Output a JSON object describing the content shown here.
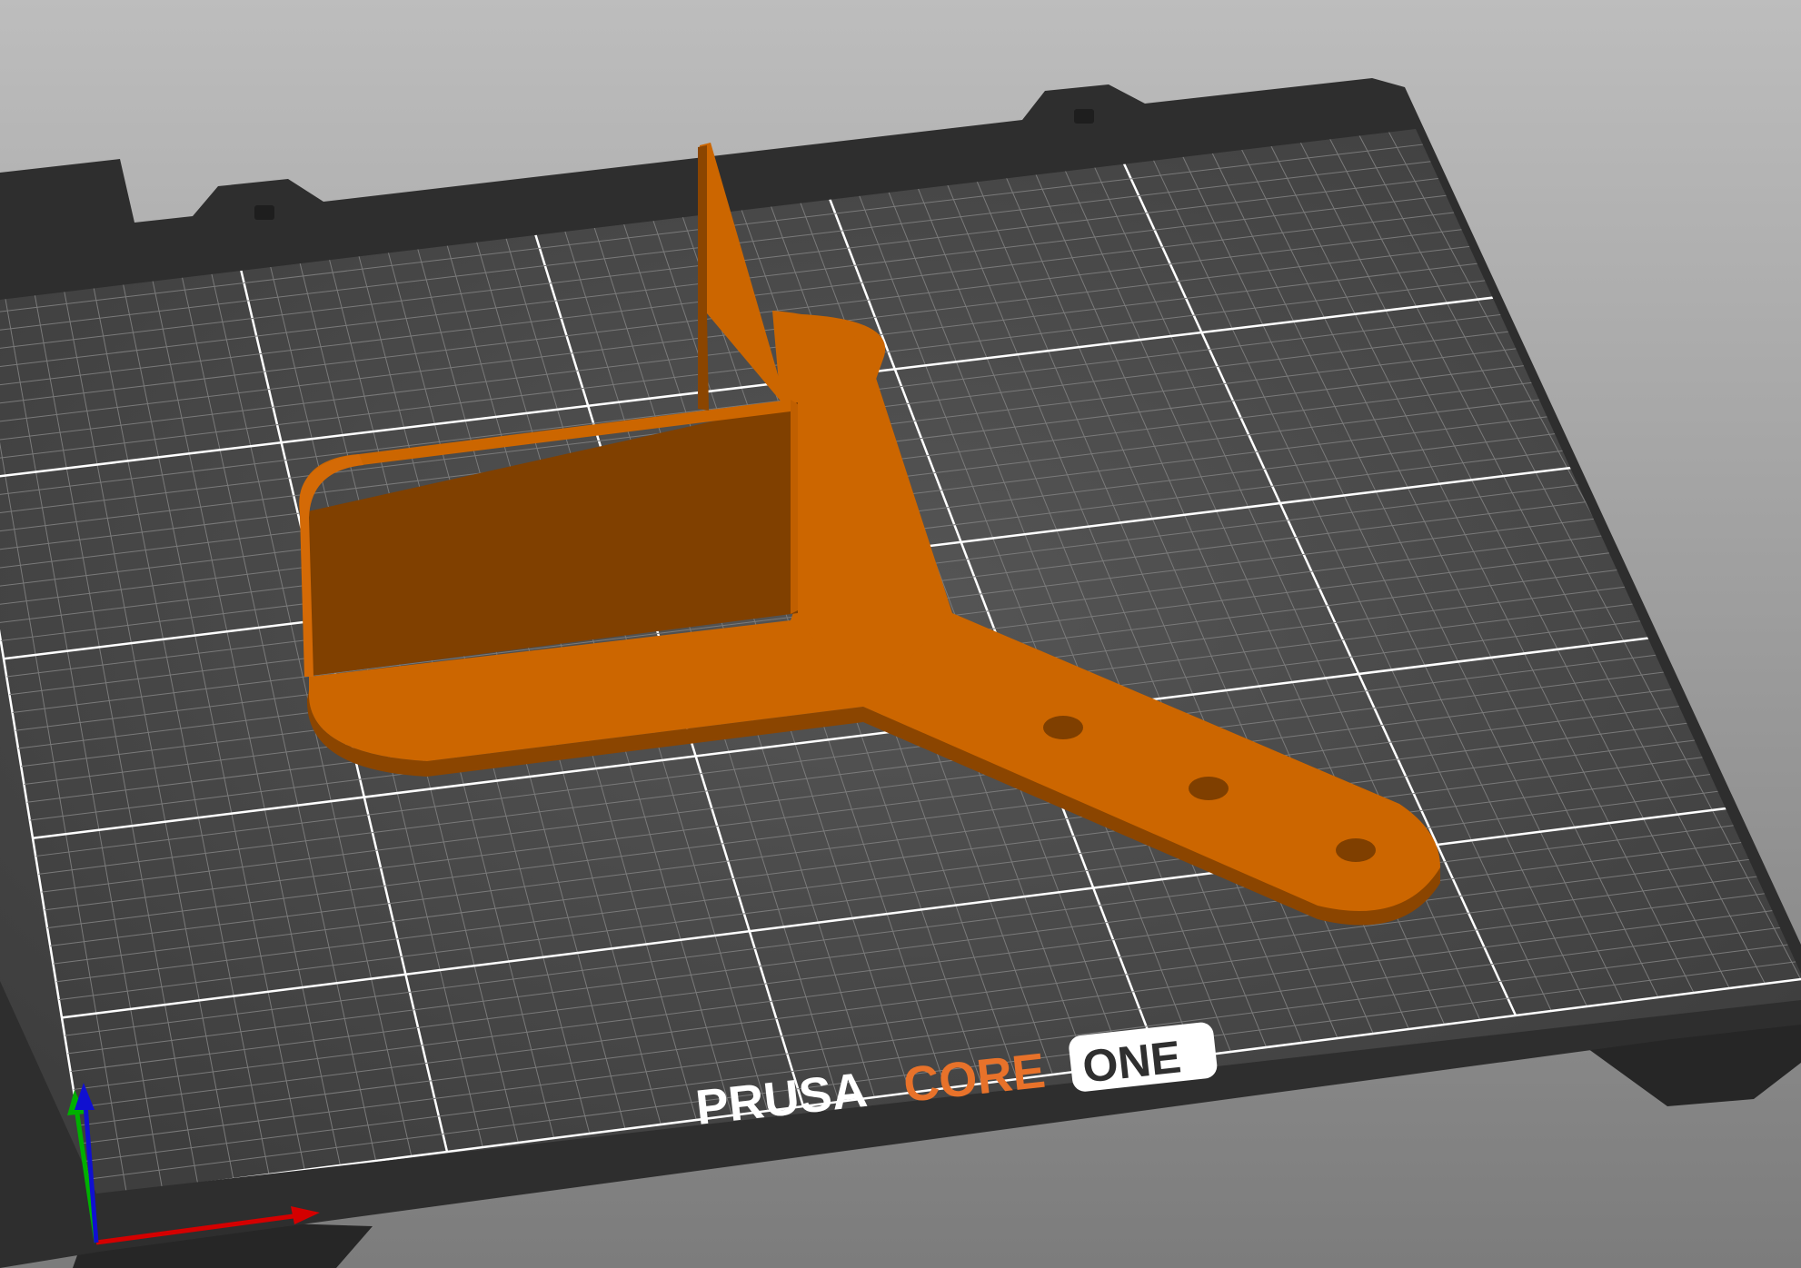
{
  "scene": {
    "background_top": "#b9b9b9",
    "background_bottom": "#7f7f7f",
    "bed_color": "#2f2f2f",
    "sheet_color": "#444444",
    "grid_color": "#7a7a7a",
    "grid_major_color": "#ffffff",
    "model_color": "#cc6600",
    "model_shadow": "#7f3f00",
    "model_dark": "#8b4500"
  },
  "bed_logo": {
    "brand": "PRUSA",
    "model": "CORE",
    "badge": "ONE",
    "brand_color": "#ffffff",
    "model_color": "#e8722a",
    "badge_text_color": "#2f2f2f",
    "badge_bg": "#ffffff"
  },
  "axes": {
    "x_color": "#d40000",
    "y_color": "#00b000",
    "z_color": "#1010d0"
  },
  "model": {
    "icon": "bracket-part",
    "holes": 3
  }
}
